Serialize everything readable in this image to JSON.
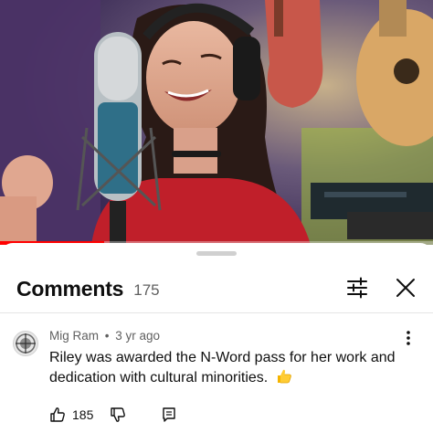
{
  "video": {
    "progress_fraction": 0.24,
    "progress_color": "#ff0000"
  },
  "comments_panel": {
    "title": "Comments",
    "count": "175",
    "icons": {
      "filter": "sliders-icon",
      "close": "close-icon"
    }
  },
  "comment": {
    "author": "Mig Ram",
    "separator": "•",
    "time": "3 yr ago",
    "text": "Riley was awarded the N-Word pass for her work and dedication with cultural minorities.",
    "emoji": "thumbs-up-emoji",
    "likes": "185",
    "icons": {
      "more": "more-vert-icon",
      "like": "thumbs-up-icon",
      "dislike": "thumbs-down-icon",
      "reply": "reply-icon",
      "avatar": "compass-avatar-icon"
    }
  }
}
